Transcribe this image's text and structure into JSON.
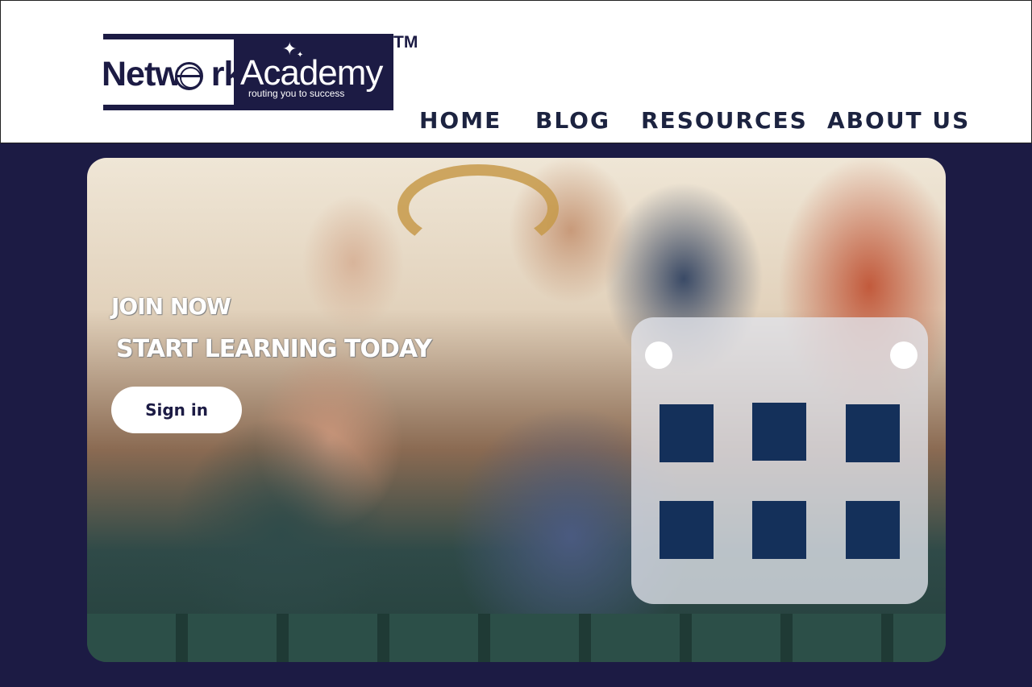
{
  "header": {
    "logo": {
      "brand_left": "Netw",
      "brand_left_end": "rk",
      "brand_right": "Academy",
      "tagline": "routing you to success",
      "trademark": "TM"
    },
    "nav": [
      "HOME",
      "BLOG",
      "RESOURCES",
      "ABOUT US"
    ]
  },
  "hero": {
    "headline": "JOIN NOW",
    "subheadline": "START LEARNING TODAY",
    "signin_label": "Sign in"
  },
  "colors": {
    "brand_navy": "#1c1b44",
    "calendar_cell": "#14305a",
    "header_bg": "#ffffff"
  },
  "icons": [
    "globe-icon",
    "sparkle-icon",
    "calendar-icon"
  ]
}
